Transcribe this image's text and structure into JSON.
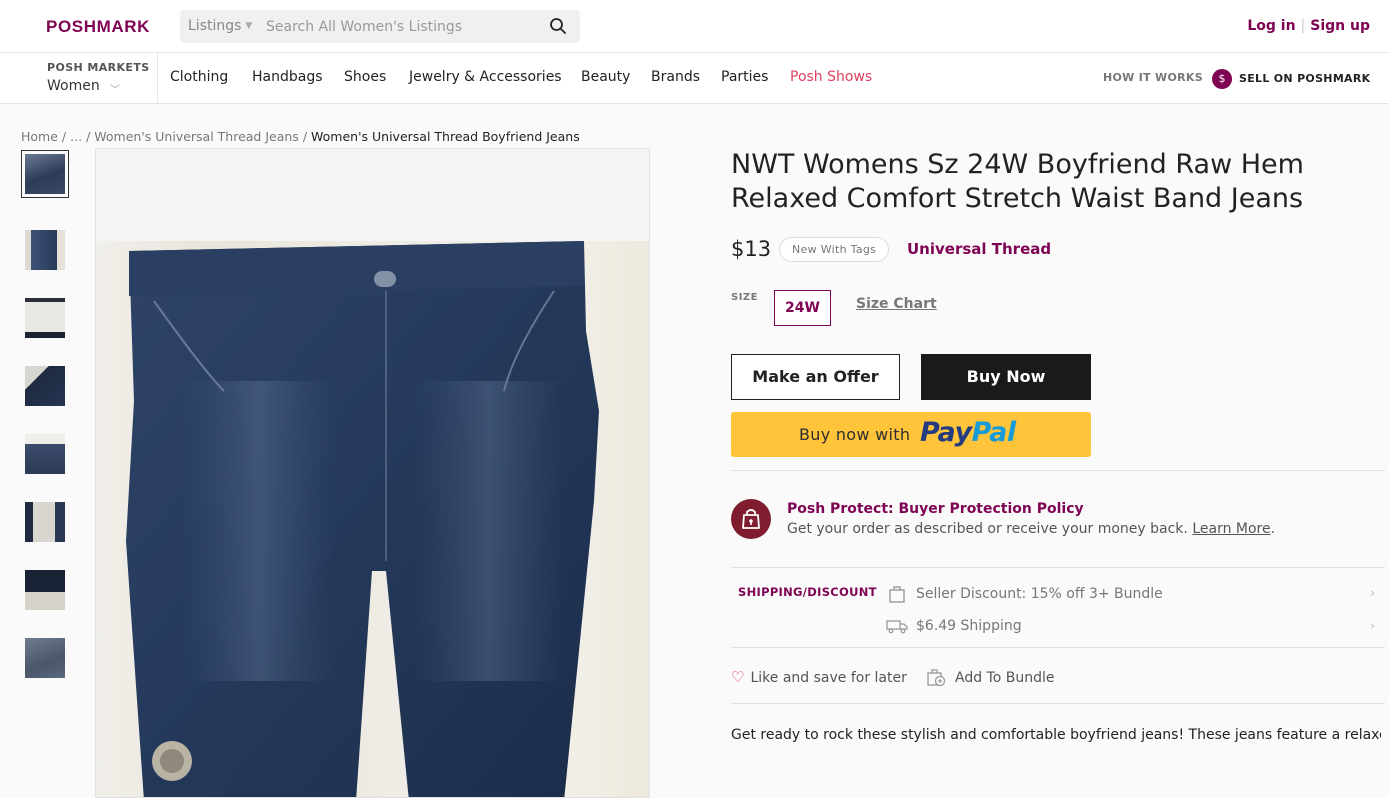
{
  "header": {
    "logo": "POSHMARK",
    "search": {
      "scope": "Listings",
      "placeholder": "Search All Women's Listings"
    },
    "login": "Log in",
    "signup": "Sign up"
  },
  "nav": {
    "markets_label": "POSH MARKETS",
    "markets_value": "Women",
    "items": [
      "Clothing",
      "Handbags",
      "Shoes",
      "Jewelry & Accessories",
      "Beauty",
      "Brands",
      "Parties",
      "Posh Shows"
    ],
    "how_it_works": "HOW IT WORKS",
    "sell": "SELL ON POSHMARK",
    "sell_badge": "$"
  },
  "breadcrumb": {
    "items": [
      "Home",
      "...",
      "Women's Universal Thread Jeans"
    ],
    "current": "Women's Universal Thread Boyfriend Jeans"
  },
  "listing": {
    "title": "NWT Womens Sz 24W Boyfriend Raw Hem Relaxed Comfort Stretch Waist Band Jeans",
    "price": "$13",
    "condition": "New With Tags",
    "brand": "Universal Thread",
    "size_label": "SIZE",
    "size": "24W",
    "size_chart": "Size Chart",
    "description": "Get ready to rock these stylish and comfortable boyfriend jeans! These jeans feature a relaxed fit,"
  },
  "actions": {
    "offer": "Make an Offer",
    "buy": "Buy Now",
    "paypal_prefix": "Buy now with",
    "paypal_logo_1": "Pay",
    "paypal_logo_2": "Pal"
  },
  "protect": {
    "title": "Posh Protect: Buyer Protection Policy",
    "desc": "Get your order as described or receive your money back.",
    "learn_more": "Learn More",
    "period": "."
  },
  "shipping": {
    "label": "SHIPPING/DISCOUNT",
    "discount": "Seller Discount: 15% off 3+ Bundle",
    "cost": "$6.49 Shipping"
  },
  "social": {
    "like": "Like and save for later",
    "bundle": "Add To Bundle"
  },
  "colors": {
    "brand": "#7f0353",
    "posh_shows": "#e0405e",
    "paypal_button": "#ffc43a"
  },
  "thumbnails_count": 8
}
